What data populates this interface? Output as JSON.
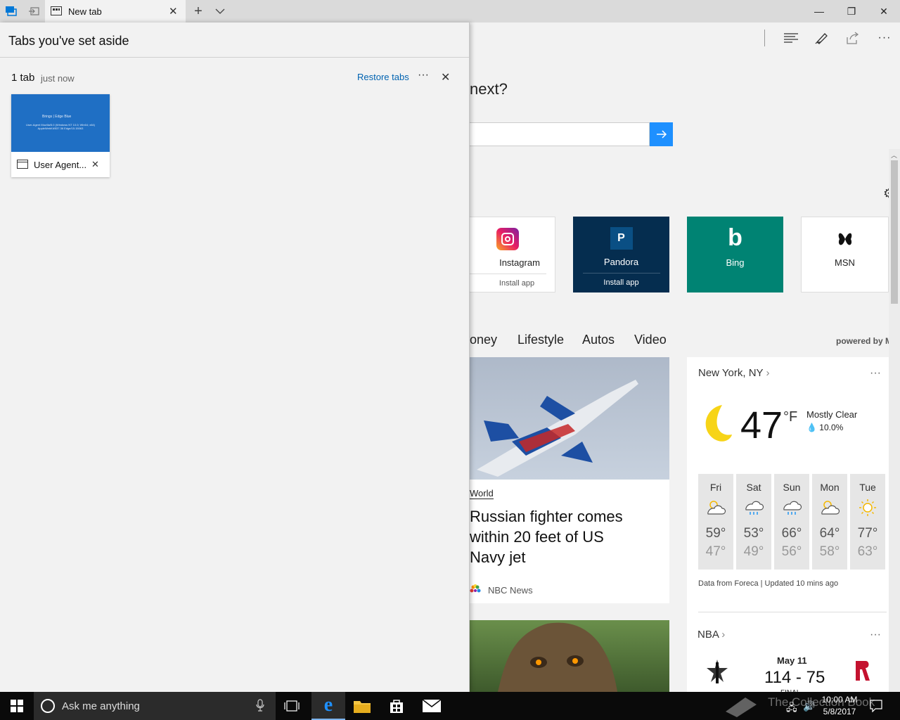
{
  "browser": {
    "active_tab_title": "New tab",
    "window_controls": {
      "minimize": "—",
      "restore": "❐",
      "close": "✕"
    }
  },
  "panel": {
    "title": "Tabs you've set aside",
    "group_count": "1 tab",
    "group_time": "just now",
    "restore_label": "Restore tabs",
    "more_label": "···",
    "tab_card_title": "User Agent...",
    "thumb_line1": "Brings | Edge Blue",
    "thumb_line2": "User-Agent Mozilla/5.0 (Windows NT 10.0; Win64; x64) AppleWebKit/537.36 Edge/15.15063"
  },
  "newtab": {
    "question": "next?",
    "tiles": [
      {
        "name": "Instagram",
        "action": "Install app",
        "icon": "instagram-icon",
        "bg": "#ffffff"
      },
      {
        "name": "Pandora",
        "action": "Install app",
        "icon": "pandora-icon",
        "bg": "#052d4f",
        "icon_letter": "P"
      },
      {
        "name": "Bing",
        "action": "",
        "icon": "bing-icon",
        "bg": "#008373",
        "icon_letter": "b"
      },
      {
        "name": "MSN",
        "action": "",
        "icon": "msn-icon",
        "bg": "#ffffff"
      }
    ],
    "categories": [
      "oney",
      "Lifestyle",
      "Autos",
      "Video"
    ],
    "powered_by": "powered by MS",
    "article": {
      "category": "World",
      "headline": "Russian fighter comes within 20 feet of US Navy jet",
      "source": "NBC News"
    }
  },
  "weather": {
    "location": "New York, NY",
    "temp": "47",
    "unit": "°F",
    "condition": "Mostly Clear",
    "precip": "10.0%",
    "forecast": [
      {
        "day": "Fri",
        "high": "59°",
        "low": "47°",
        "icon": "partly-cloudy-icon"
      },
      {
        "day": "Sat",
        "high": "53°",
        "low": "49°",
        "icon": "rain-icon"
      },
      {
        "day": "Sun",
        "high": "66°",
        "low": "56°",
        "icon": "rain-icon"
      },
      {
        "day": "Mon",
        "high": "64°",
        "low": "58°",
        "icon": "partly-cloudy-icon"
      },
      {
        "day": "Tue",
        "high": "77°",
        "low": "63°",
        "icon": "sunny-icon"
      }
    ],
    "footer": "Data from Foreca | Updated 10 mins ago"
  },
  "nba": {
    "title": "NBA",
    "date": "May 11",
    "score": "114 - 75",
    "status": "FINAL"
  },
  "taskbar": {
    "search_placeholder": "Ask me anything",
    "time": "10:00 AM",
    "date": "5/8/2017",
    "watermark": "The Collection Book"
  },
  "colors": {
    "accent": "#0078d7",
    "panel_bg": "#f2f2f2",
    "taskbar_bg": "#0a0a0a"
  }
}
